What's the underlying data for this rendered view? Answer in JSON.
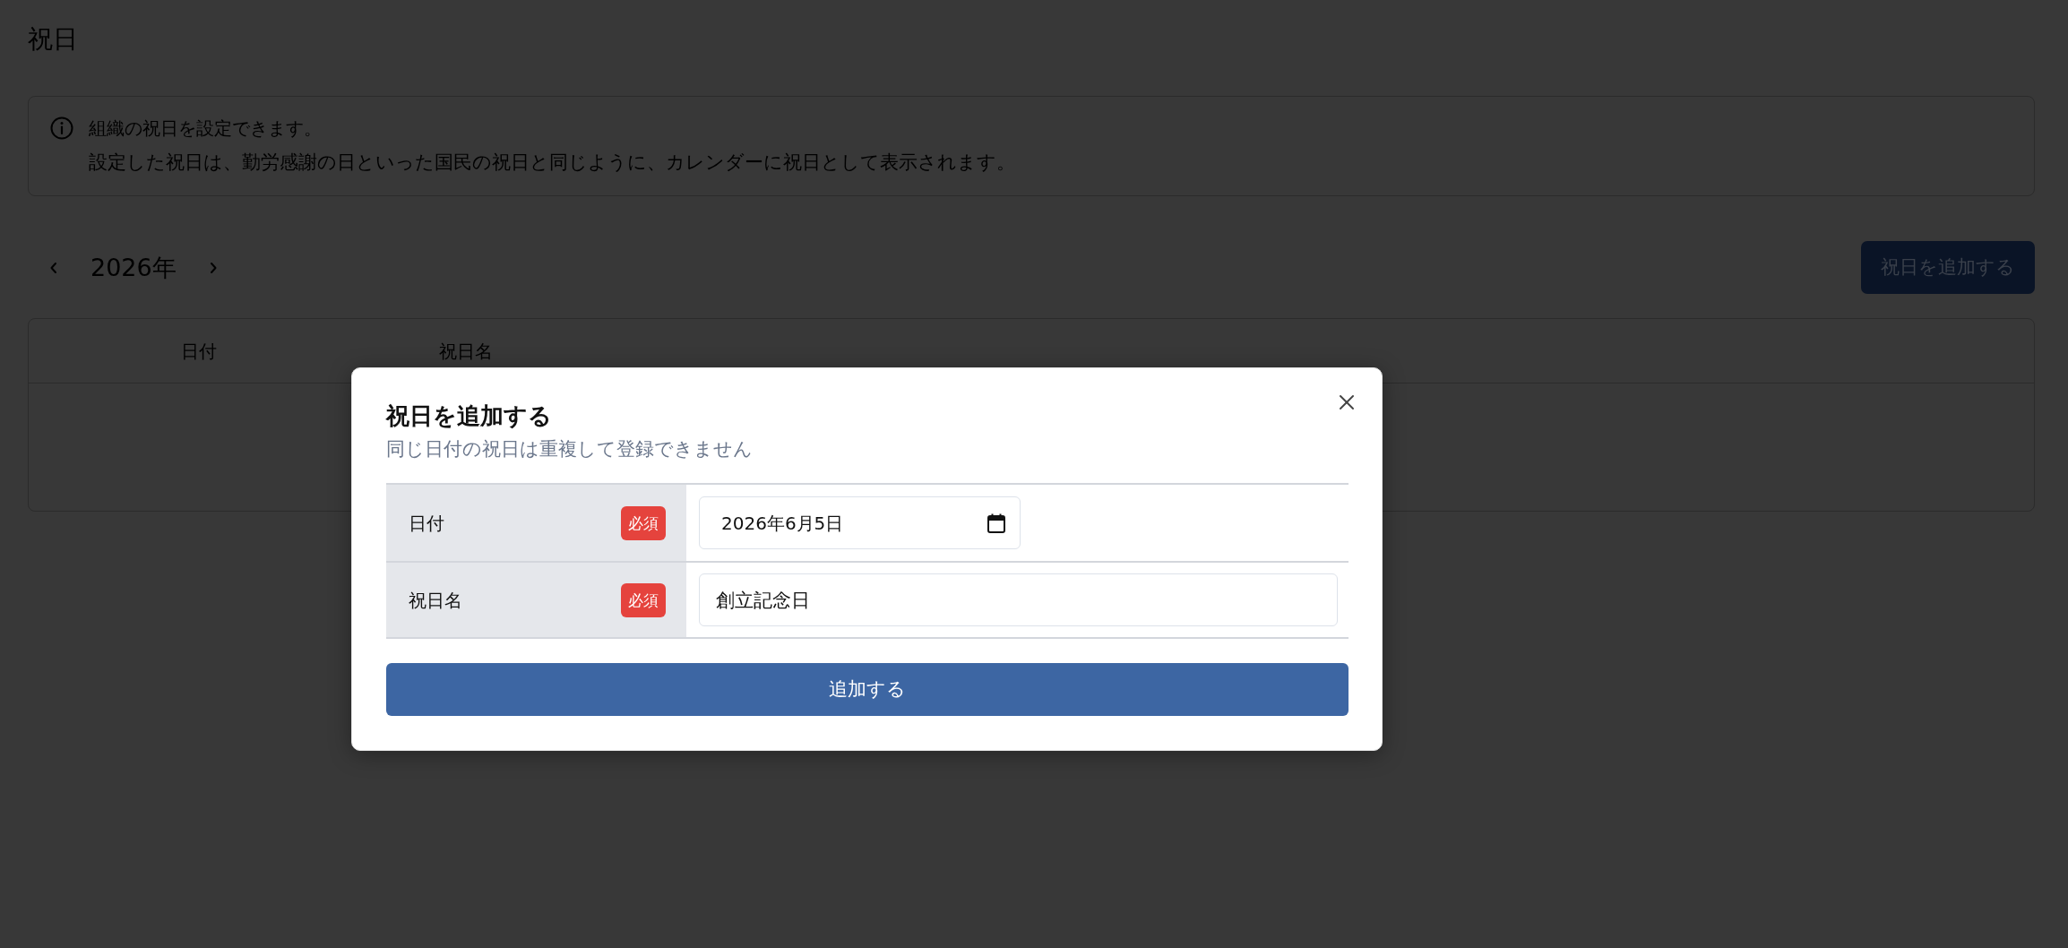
{
  "page": {
    "title": "祝日"
  },
  "info": {
    "heading": "組織の祝日を設定できます。",
    "text": "設定した祝日は、勤労感謝の日といった国民の祝日と同じように、カレンダーに祝日として表示されます。"
  },
  "year_nav": {
    "year": "2026年"
  },
  "add_button": "祝日を追加する",
  "table": {
    "columns": [
      "日付",
      "祝日名"
    ]
  },
  "modal": {
    "title": "祝日を追加する",
    "subtitle": "同じ日付の祝日は重複して登録できません",
    "fields": [
      {
        "kind": "date",
        "label": "日付",
        "badge": "必須",
        "value": "2026年6月5日"
      },
      {
        "kind": "text",
        "label": "祝日名",
        "badge": "必須",
        "value": "創立記念日"
      }
    ],
    "submit": "追加する"
  }
}
